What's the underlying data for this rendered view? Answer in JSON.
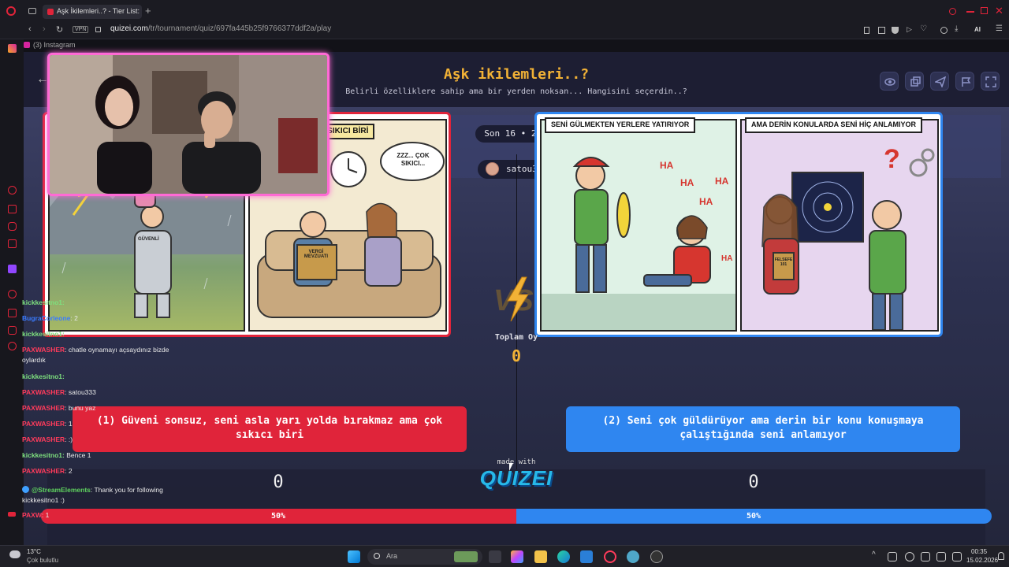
{
  "browser": {
    "tab_title": "Aşk İkilemleri..? - Tier List:",
    "address_prefix": "quizei.com",
    "address_path": "/tr/tournament/quiz/697fa445b25f9766377ddf2a/play",
    "vpn_label": "VPN",
    "bookmark": "(3) Instagram",
    "ai_label": "AI"
  },
  "quiz": {
    "title": "Aşk ikilemleri..?",
    "description": "Belirli özelliklere sahip ama bir yerden noksan... Hangisini seçerdin..?",
    "round": "Son 16 • 2/8",
    "user": "satou333",
    "total_label": "Toplam Oy",
    "total_value": "0",
    "left_option": "(1) Güveni sonsuz, seni asla yarı yolda bırakmaz ama çok sıkıcı biri",
    "right_option": "(2) Seni çok güldürüyor ama derin bir konu konuşmaya çalıştığında seni anlamıyor",
    "left_votes": "0",
    "right_votes": "0",
    "left_pct": "50%",
    "right_pct": "50%",
    "left_share": 0.5,
    "made_with": "made with",
    "logo": "QUIZEI",
    "colors": {
      "accent": "#f2b236",
      "left": "#e0243a",
      "right": "#2f86f0"
    }
  },
  "left_image": {
    "caption": "AMA ÇOK SIKICI BİRİ",
    "bubble": "ZZZ... ÇOK SIKICI...",
    "book": "VERGİ MEVZUATI",
    "armor": "GÜVENLİ"
  },
  "right_image": {
    "caption_left": "SENİ GÜLMEKTEN YERLERE YATIRIYOR",
    "caption_right": "AMA DERİN KONULARDA SENİ HİÇ ANLAMIYOR",
    "ha": "HA",
    "book": "FELSEFE 101"
  },
  "chat": [
    {
      "user": "kickkesitno1:",
      "msg": "",
      "color": "#7ee07e"
    },
    {
      "user": "BugraCorleone",
      "msg": ": 2",
      "color": "#3a7bff"
    },
    {
      "user": "kickkesitno1:",
      "msg": "",
      "color": "#7ee07e"
    },
    {
      "user": "PAXWASHER",
      "msg": ": chatle oynamayı açsaydınız bizde oylardık",
      "color": "#ff3b5b"
    },
    {
      "user": "kickkesitno1:",
      "msg": "",
      "color": "#7ee07e"
    },
    {
      "user": "PAXWASHER",
      "msg": ": satou333",
      "color": "#ff3b5b"
    },
    {
      "user": "PAXWASHER",
      "msg": ": bunu yaz",
      "color": "#ff3b5b"
    },
    {
      "user": "PAXWASHER",
      "msg": ": 1",
      "color": "#ff3b5b"
    },
    {
      "user": "PAXWASHER",
      "msg": ": :)",
      "color": "#ff3b5b"
    },
    {
      "user": "kickkesitno1:",
      "msg": " Bence 1",
      "color": "#7ee07e"
    },
    {
      "user": "PAXWASHER",
      "msg": ": 2",
      "color": "#ff3b5b"
    },
    {
      "user": "@StreamElements",
      "msg": ": Thank you for following kickkesitno1 :)",
      "color": "#5fd35f"
    },
    {
      "user": "PAXW",
      "msg": ": 1",
      "color": "#ff3b5b"
    }
  ],
  "taskbar": {
    "weather_temp": "13°C",
    "weather_desc": "Çok bulutlu",
    "search_placeholder": "Ara",
    "time": "00:35",
    "date": "15.02.2026"
  }
}
